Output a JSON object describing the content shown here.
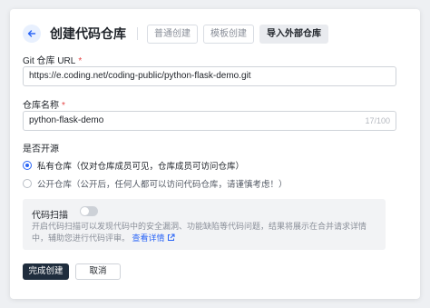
{
  "header": {
    "title": "创建代码仓库",
    "tabs": [
      {
        "label": "普通创建",
        "active": false
      },
      {
        "label": "模板创建",
        "active": false
      },
      {
        "label": "导入外部仓库",
        "active": true
      }
    ]
  },
  "git_url": {
    "label": "Git 仓库 URL",
    "required_mark": "*",
    "value": "https://e.coding.net/coding-public/python-flask-demo.git"
  },
  "repo_name": {
    "label": "仓库名称",
    "required_mark": "*",
    "value": "python-flask-demo",
    "counter": "17/100"
  },
  "open_source": {
    "label": "是否开源",
    "options": [
      {
        "label": "私有仓库（仅对仓库成员可见，仓库成员可访问仓库）",
        "checked": true
      },
      {
        "label": "公开仓库（公开后，任何人都可以访问代码仓库，请谨慎考虑！）",
        "checked": false
      }
    ]
  },
  "code_scan": {
    "title": "代码扫描",
    "enabled": false,
    "description": "开启代码扫描可以发现代码中的安全漏洞、功能缺陷等代码问题，结果将展示在合并请求详情中，辅助您进行代码评审。",
    "link_label": "查看详情"
  },
  "actions": {
    "submit_label": "完成创建",
    "cancel_label": "取消"
  },
  "colors": {
    "accent": "#2a65f6",
    "primary_button": "#1f2d3d",
    "required": "#e54545"
  }
}
